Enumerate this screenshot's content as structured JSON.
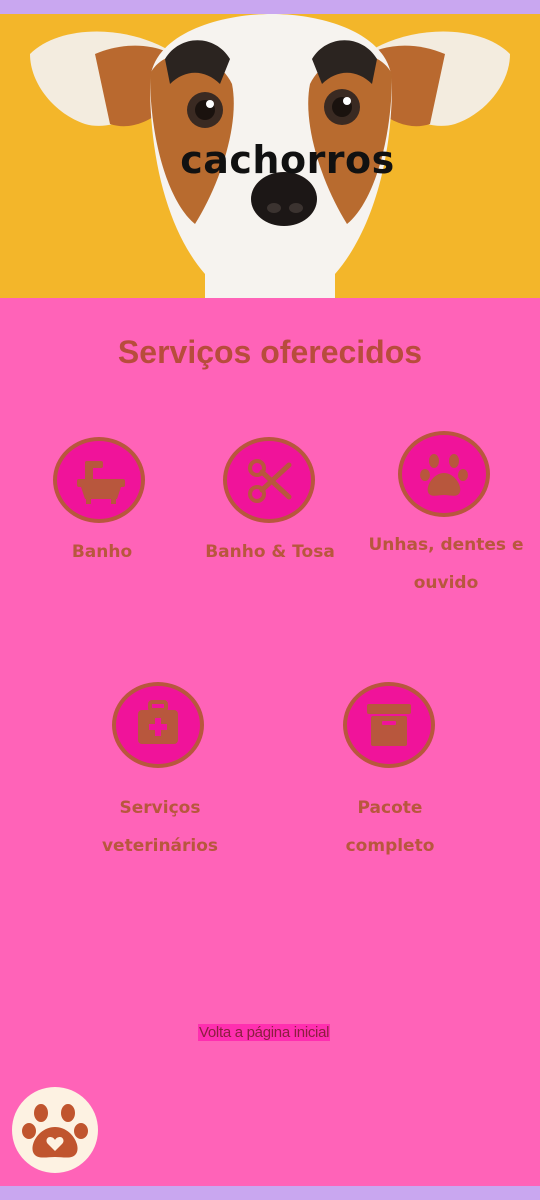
{
  "hero": {
    "title": "cachorros"
  },
  "services": {
    "heading": "Serviços oferecidos",
    "items": [
      {
        "label": "Banho",
        "icon": "bathtub-icon"
      },
      {
        "label": "Banho & Tosa",
        "icon": "scissors-icon"
      },
      {
        "label": "Unhas, dentes e ouvido",
        "icon": "paw-icon"
      },
      {
        "label": "Serviços veterinários",
        "icon": "medical-kit-icon"
      },
      {
        "label": "Pacote completo",
        "icon": "archive-box-icon"
      }
    ]
  },
  "footer": {
    "back_link": "Volta a página inicial"
  },
  "colors": {
    "background": "#ff63b8",
    "accent": "#f0139a",
    "icon_brown": "#b8573d",
    "bars": "#c9a7f0"
  }
}
